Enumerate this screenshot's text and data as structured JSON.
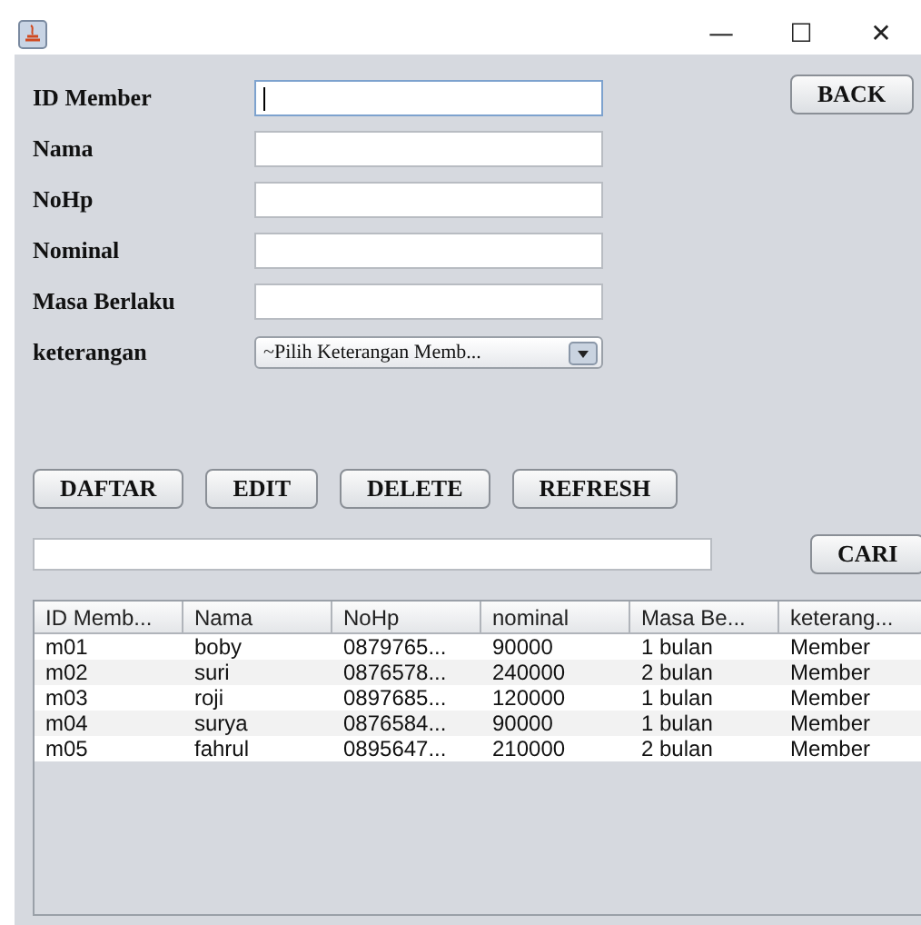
{
  "window": {
    "title_bar_buttons": [
      "—",
      "☐",
      "✕"
    ]
  },
  "form": {
    "fields": [
      {
        "label": "ID Member",
        "kind": "text",
        "focused": true
      },
      {
        "label": "Nama",
        "kind": "text",
        "focused": false
      },
      {
        "label": "NoHp",
        "kind": "text",
        "focused": false
      },
      {
        "label": "Nominal",
        "kind": "text",
        "focused": false
      },
      {
        "label": "Masa Berlaku",
        "kind": "text",
        "focused": false
      },
      {
        "label": "keterangan",
        "kind": "combo",
        "value": "~Pilih Keterangan Memb..."
      }
    ],
    "back_button": "BACK"
  },
  "actions": [
    "DAFTAR",
    "EDIT",
    "DELETE",
    "REFRESH"
  ],
  "search": {
    "button": "CARI"
  },
  "table": {
    "columns": [
      "ID Memb...",
      "Nama",
      "NoHp",
      "nominal",
      "Masa Be...",
      "keterang..."
    ],
    "rows": [
      [
        "m01",
        "boby",
        "0879765...",
        "90000",
        "1 bulan",
        "Member"
      ],
      [
        "m02",
        "suri",
        "0876578...",
        "240000",
        "2 bulan",
        "Member"
      ],
      [
        "m03",
        "roji",
        "0897685...",
        "120000",
        "1 bulan",
        "Member"
      ],
      [
        "m04",
        "surya",
        "0876584...",
        "90000",
        "1 bulan",
        "Member"
      ],
      [
        "m05",
        "fahrul",
        "0895647...",
        "210000",
        "2 bulan",
        "Member"
      ]
    ]
  }
}
